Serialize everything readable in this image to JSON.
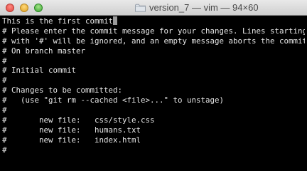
{
  "window": {
    "title": "version_7 — vim — 94×60",
    "title_icon": "folder-icon"
  },
  "editor": {
    "lines": [
      "This is the first commit",
      "# Please enter the commit message for your changes. Lines starting",
      "# with '#' will be ignored, and an empty message aborts the commit.",
      "# On branch master",
      "#",
      "# Initial commit",
      "#",
      "# Changes to be committed:",
      "#   (use \"git rm --cached <file>...\" to unstage)",
      "#",
      "#       new file:   css/style.css",
      "#       new file:   humans.txt",
      "#       new file:   index.html",
      "#"
    ]
  },
  "colors": {
    "background": "#000000",
    "text": "#e6e6e6",
    "cursor": "#9a9a9a"
  }
}
